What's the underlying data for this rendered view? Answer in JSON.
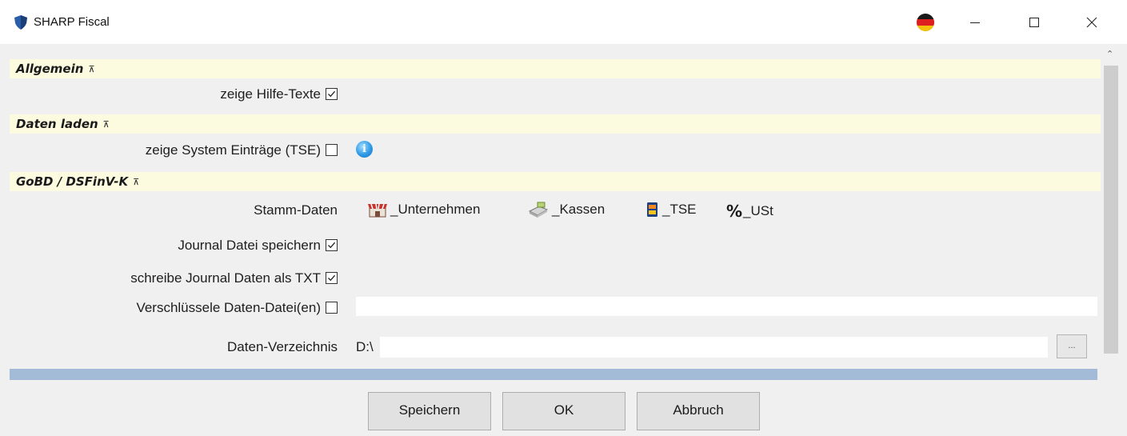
{
  "window": {
    "title": "SHARP Fiscal",
    "controls": {
      "minimize": "minimize-icon",
      "maximize": "maximize-icon",
      "close": "close-icon"
    }
  },
  "sections": {
    "allgemein": {
      "title": "Allgemein"
    },
    "daten_laden": {
      "title": "Daten laden"
    },
    "gobd": {
      "title": "GoBD / DSFinV-K"
    }
  },
  "settings": {
    "hilfe_texte": {
      "label": "zeige Hilfe-Texte",
      "checked": true
    },
    "system_eintraege": {
      "label": "zeige System Einträge (TSE)",
      "checked": false
    },
    "stamm_daten": {
      "label": "Stamm-Daten"
    },
    "journal_speichern": {
      "label": "Journal Datei speichern",
      "checked": true
    },
    "journal_txt": {
      "label": "schreibe Journal Daten als TXT",
      "checked": true
    },
    "verschluessele": {
      "label": "Verschlüssele Daten-Datei(en)",
      "checked": false
    },
    "daten_verzeichnis": {
      "label": "Daten-Verzeichnis",
      "value": "D:\\",
      "browse_label": "..."
    }
  },
  "stamm_links": [
    {
      "label": "_Unternehmen",
      "icon": "store-icon"
    },
    {
      "label": "_Kassen",
      "icon": "cash-register-icon"
    },
    {
      "label": "_TSE",
      "icon": "tse-device-icon"
    },
    {
      "label": "_USt",
      "icon": "percent-icon"
    }
  ],
  "buttons": {
    "save": "Speichern",
    "ok": "OK",
    "cancel": "Abbruch"
  },
  "colors": {
    "section_header_bg": "#fcfbe0",
    "content_bg": "#f0f0f0",
    "progress_bar": "#a3bbd6"
  }
}
